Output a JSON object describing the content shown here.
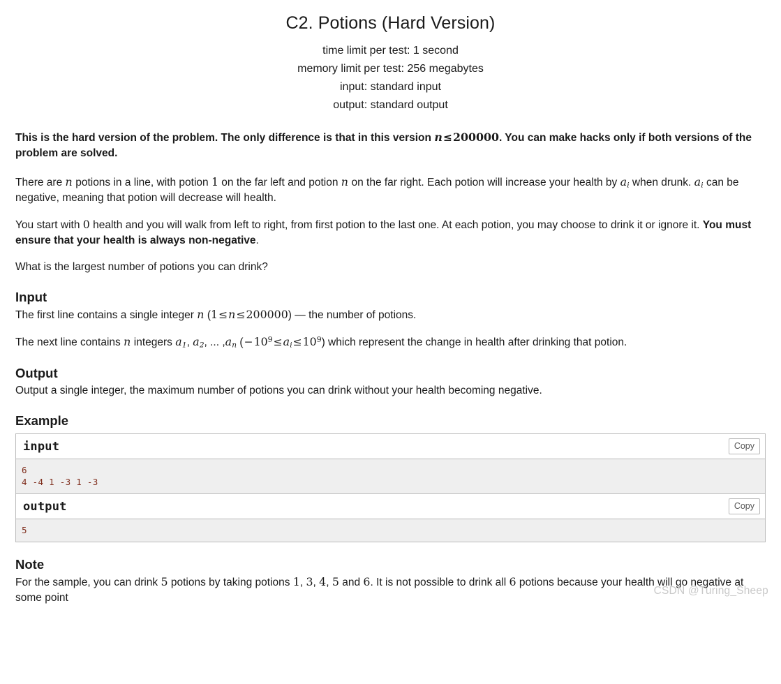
{
  "header": {
    "title": "C2. Potions (Hard Version)",
    "time_limit": "time limit per test: 1 second",
    "memory_limit": "memory limit per test: 256 megabytes",
    "input_spec": "input: standard input",
    "output_spec": "output: standard output"
  },
  "hard_version_note": {
    "part1": "This is the hard version of the problem. The only difference is that in this version ",
    "math_n": "n",
    "math_le": "≤",
    "math_value": "200000",
    "part2": ". You can make hacks only if both versions of the problem are solved."
  },
  "paragraphs": {
    "p1": {
      "t1": "There are ",
      "m1": "n",
      "t2": " potions in a line, with potion ",
      "m2": "1",
      "t3": " on the far left and potion ",
      "m3": "n",
      "t4": " on the far right. Each potion will increase your health by ",
      "m4": "a",
      "m4sub": "i",
      "t5": " when drunk. ",
      "m5": "a",
      "m5sub": "i",
      "t6": " can be negative, meaning that potion will decrease will health."
    },
    "p2": {
      "t1": "You start with ",
      "m1": "0",
      "t2": " health and you will walk from left to right, from first potion to the last one. At each potion, you may choose to drink it or ignore it. ",
      "bold": "You must ensure that your health is always non-negative",
      "t3": "."
    },
    "p3": "What is the largest number of potions you can drink?"
  },
  "input_section": {
    "heading": "Input",
    "line1": {
      "t1": "The first line contains a single integer ",
      "m1": "n",
      "t2": " (",
      "m2": "1",
      "le1": "≤",
      "m3": "n",
      "le2": "≤",
      "m4": "200000",
      "t3": ") — the number of potions."
    },
    "line2": {
      "t1": "The next line contains ",
      "m1": "n",
      "t2": " integers ",
      "a1": "a",
      "a1sub": "1",
      "comma1": ", ",
      "a2": "a",
      "a2sub": "2",
      "ellipsis": ", ... ,",
      "an": "a",
      "ansub": "n",
      "t3": " (",
      "neg": "−",
      "base1": "10",
      "exp1": "9",
      "le1": "≤",
      "ai": "a",
      "aisub": "i",
      "le2": "≤",
      "base2": "10",
      "exp2": "9",
      "t4": ") which represent the change in health after drinking that potion."
    }
  },
  "output_section": {
    "heading": "Output",
    "text": "Output a single integer, the maximum number of potions you can drink without your health becoming negative."
  },
  "example_section": {
    "heading": "Example",
    "tests": [
      {
        "input_label": "input",
        "input_copy_label": "Copy",
        "input_value": "6\n4 -4 1 -3 1 -3",
        "output_label": "output",
        "output_copy_label": "Copy",
        "output_value": "5"
      }
    ]
  },
  "note_section": {
    "heading": "Note",
    "t1": "For the sample, you can drink ",
    "m1": "5",
    "t2": " potions by taking potions ",
    "m2": "1",
    "c1": ", ",
    "m3": "3",
    "c2": ", ",
    "m4": "4",
    "c3": ", ",
    "m5": "5",
    "t3": " and ",
    "m6": "6",
    "t4": ". It is not possible to drink all ",
    "m7": "6",
    "t5": " potions because your health will go negative at some point"
  },
  "watermark": "CSDN @Turing_Sheep",
  "colors": {
    "text": "#1a1a1a",
    "sample_code": "#7f2d1c",
    "sample_bg": "#efefef",
    "border": "#bbbbbb",
    "watermark": "#c9c9c9"
  }
}
